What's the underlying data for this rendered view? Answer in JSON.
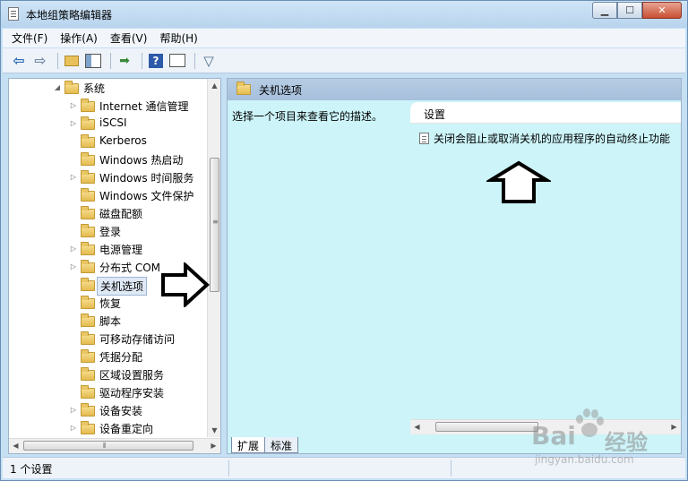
{
  "window": {
    "title": "本地组策略编辑器"
  },
  "menu": [
    "文件(F)",
    "操作(A)",
    "查看(V)",
    "帮助(H)"
  ],
  "toolbar": {
    "icons": [
      "back-icon",
      "forward-icon",
      "up-folder-icon",
      "show-hide-tree-icon",
      "export-list-icon",
      "help-icon",
      "properties-icon",
      "filter-icon"
    ]
  },
  "tree": {
    "root": "系统",
    "items": [
      {
        "label": "Internet 通信管理",
        "expandable": true
      },
      {
        "label": "iSCSI",
        "expandable": true
      },
      {
        "label": "Kerberos",
        "expandable": false
      },
      {
        "label": "Windows 热启动",
        "expandable": false
      },
      {
        "label": "Windows 时间服务",
        "expandable": true
      },
      {
        "label": "Windows 文件保护",
        "expandable": false
      },
      {
        "label": "磁盘配额",
        "expandable": false
      },
      {
        "label": "登录",
        "expandable": false
      },
      {
        "label": "电源管理",
        "expandable": true
      },
      {
        "label": "分布式 COM",
        "expandable": true
      },
      {
        "label": "关机选项",
        "expandable": false,
        "selected": true
      },
      {
        "label": "恢复",
        "expandable": false
      },
      {
        "label": "脚本",
        "expandable": false
      },
      {
        "label": "可移动存储访问",
        "expandable": false
      },
      {
        "label": "凭据分配",
        "expandable": false
      },
      {
        "label": "区域设置服务",
        "expandable": false
      },
      {
        "label": "驱动程序安装",
        "expandable": false
      },
      {
        "label": "设备安装",
        "expandable": true
      },
      {
        "label": "设备重定向",
        "expandable": true
      }
    ]
  },
  "right_pane": {
    "header": "关机选项",
    "description": "选择一个项目来查看它的描述。",
    "settings_header": "设置",
    "settings": [
      "关闭会阻止或取消关机的应用程序的自动终止功能"
    ]
  },
  "tabs": [
    "扩展",
    "标准"
  ],
  "status": {
    "text": "1 个设置"
  },
  "watermark": {
    "brand": "Bai",
    "brand_cn": "经验",
    "url": "jingyan.baidu.com"
  },
  "colors": {
    "title_bar": "#c5dff3",
    "right_pane_bg": "#ccf4f9",
    "close_button": "#c84f32",
    "folder": "#e4bb4e"
  }
}
